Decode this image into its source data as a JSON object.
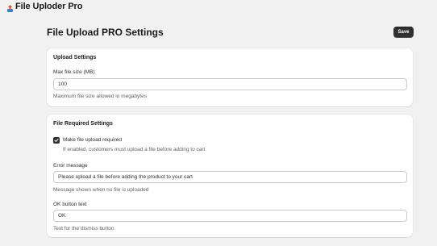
{
  "app": {
    "title": "File Uploder Pro",
    "logo_icon": "upload-logo-icon"
  },
  "page": {
    "title": "File Upload PRO Settings",
    "save_label": "Save"
  },
  "upload_settings": {
    "title": "Upload Settings",
    "max_size_label": "Max file size (MB)",
    "max_size_value": "100",
    "max_size_help": "Maximum file size allowed in megabytes"
  },
  "required_settings": {
    "title": "File Required Settings",
    "checkbox_label": "Make file upload required",
    "checkbox_checked": true,
    "checkbox_help": "If enabled, customers must upload a file before adding to cart",
    "error_label": "Error message",
    "error_value": "Please upload a file before adding the product to your cart",
    "error_help": "Message shown when no file is uploaded",
    "ok_label": "OK button text",
    "ok_value": "OK",
    "ok_help": "Text for the dismiss button"
  },
  "colors": {
    "background": "#f1f1f1",
    "card": "#ffffff",
    "primary_button": "#303030"
  }
}
